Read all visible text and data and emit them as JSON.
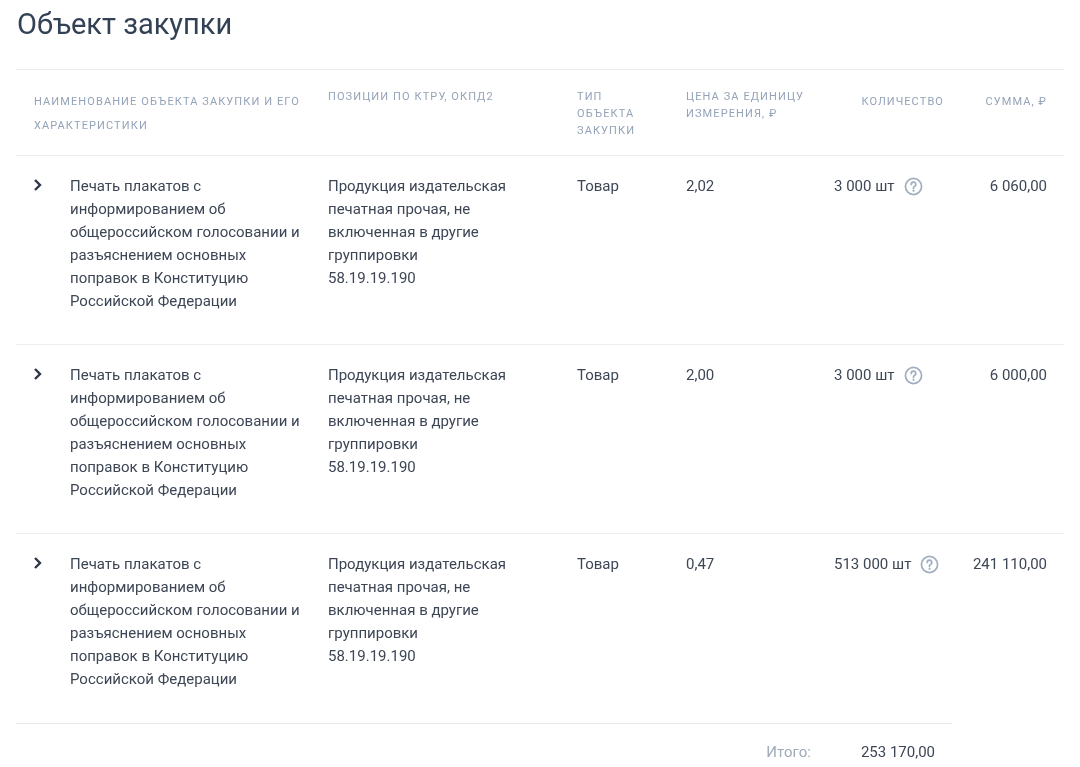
{
  "title": "Объект закупки",
  "table": {
    "columns": [
      "НАИМЕНОВАНИЕ ОБЪЕКТА ЗАКУПКИ И ЕГО ХАРАКТЕРИСТИКИ",
      "ПОЗИЦИИ ПО КТРУ, ОКПД2",
      "ТИП ОБЪЕКТА ЗАКУПКИ",
      "ЦЕНА ЗА ЕДИНИЦУ ИЗМЕРЕНИЯ, ₽",
      "КОЛИЧЕСТВО",
      "СУММА, ₽"
    ],
    "rows": [
      {
        "expanded": false,
        "name": "Печать плакатов с информированием об общероссийском голосовании и разъяснением основных поправок в Конституцию Российской Федерации",
        "position": "Продукция издательская печатная прочая, не включенная в другие группировки",
        "code": "58.19.19.190",
        "type": "Товар",
        "price": "2,02",
        "quantity": "3 000 шт",
        "sum": "6 060,00"
      },
      {
        "expanded": false,
        "name": "Печать плакатов с информированием об общероссийском голосовании и разъяснением основных поправок в Конституцию Российской Федерации",
        "position": "Продукция издательская печатная прочая, не включенная в другие группировки",
        "code": "58.19.19.190",
        "type": "Товар",
        "price": "2,00",
        "quantity": "3 000 шт",
        "sum": "6 000,00"
      },
      {
        "expanded": false,
        "name": "Печать плакатов с информированием об общероссийском голосовании и разъяснением основных поправок в Конституцию Российской Федерации",
        "position": "Продукция издательская печатная прочая, не включенная в другие группировки",
        "code": "58.19.19.190",
        "type": "Товар",
        "price": "0,47",
        "quantity": "513 000 шт",
        "sum": "241 110,00"
      }
    ]
  },
  "total": {
    "label": "Итого:",
    "value": "253 170,00"
  }
}
